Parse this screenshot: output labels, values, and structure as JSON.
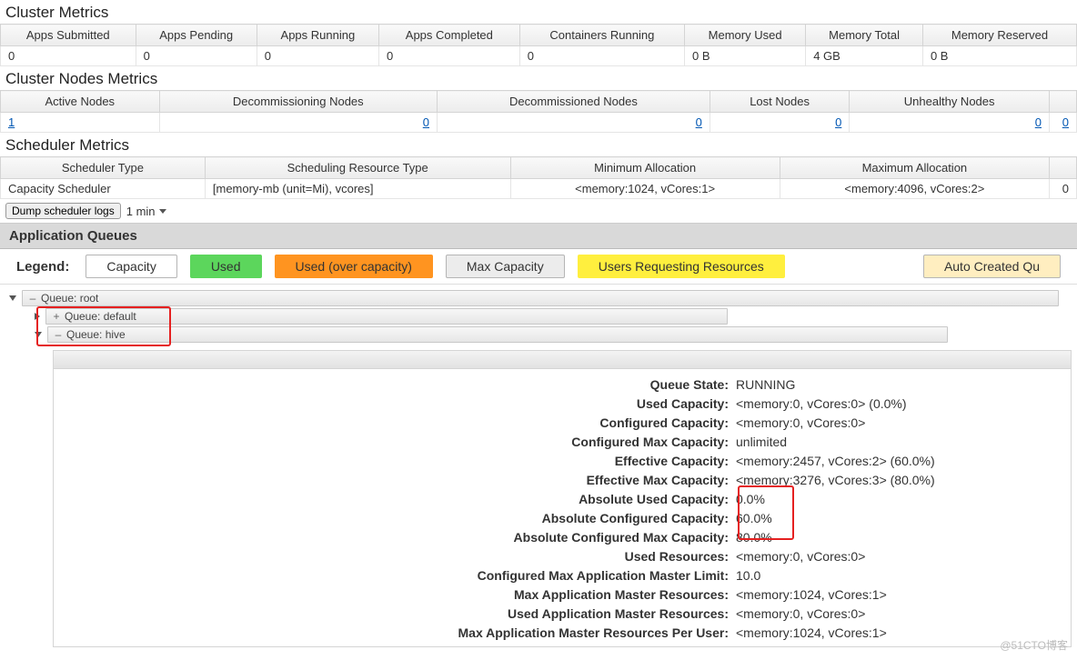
{
  "sections": {
    "cluster": "Cluster Metrics",
    "nodes": "Cluster Nodes Metrics",
    "scheduler": "Scheduler Metrics",
    "appqueues": "Application Queues"
  },
  "cluster_metrics": {
    "headers": [
      "Apps Submitted",
      "Apps Pending",
      "Apps Running",
      "Apps Completed",
      "Containers Running",
      "Memory Used",
      "Memory Total",
      "Memory Reserved"
    ],
    "values": [
      "0",
      "0",
      "0",
      "0",
      "0",
      "0 B",
      "4 GB",
      "0 B"
    ]
  },
  "node_metrics": {
    "headers": [
      "Active Nodes",
      "Decommissioning Nodes",
      "Decommissioned Nodes",
      "Lost Nodes",
      "Unhealthy Nodes",
      ""
    ],
    "values": [
      "1",
      "0",
      "0",
      "0",
      "0",
      "0"
    ]
  },
  "scheduler_metrics": {
    "headers": [
      "Scheduler Type",
      "Scheduling Resource Type",
      "Minimum Allocation",
      "Maximum Allocation",
      ""
    ],
    "values": [
      "Capacity Scheduler",
      "[memory-mb (unit=Mi), vcores]",
      "<memory:1024, vCores:1>",
      "<memory:4096, vCores:2>",
      "0"
    ]
  },
  "dump": {
    "button": "Dump scheduler logs",
    "period": "1 min"
  },
  "legend": {
    "label": "Legend:",
    "capacity": "Capacity",
    "used": "Used",
    "over": "Used (over capacity)",
    "max": "Max Capacity",
    "users": "Users Requesting Resources",
    "auto": "Auto Created Qu"
  },
  "tree": {
    "root": "Queue: root",
    "default": "Queue: default",
    "hive": "Queue: hive"
  },
  "details": {
    "rows": [
      {
        "k": "Queue State:",
        "v": "RUNNING"
      },
      {
        "k": "Used Capacity:",
        "v": "<memory:0, vCores:0> (0.0%)"
      },
      {
        "k": "Configured Capacity:",
        "v": "<memory:0, vCores:0>"
      },
      {
        "k": "Configured Max Capacity:",
        "v": "unlimited"
      },
      {
        "k": "Effective Capacity:",
        "v": "<memory:2457, vCores:2> (60.0%)"
      },
      {
        "k": "Effective Max Capacity:",
        "v": "<memory:3276, vCores:3> (80.0%)"
      },
      {
        "k": "Absolute Used Capacity:",
        "v": "0.0%"
      },
      {
        "k": "Absolute Configured Capacity:",
        "v": "60.0%"
      },
      {
        "k": "Absolute Configured Max Capacity:",
        "v": "80.0%"
      },
      {
        "k": "Used Resources:",
        "v": "<memory:0, vCores:0>"
      },
      {
        "k": "Configured Max Application Master Limit:",
        "v": "10.0"
      },
      {
        "k": "Max Application Master Resources:",
        "v": "<memory:1024, vCores:1>"
      },
      {
        "k": "Used Application Master Resources:",
        "v": "<memory:0, vCores:0>"
      },
      {
        "k": "Max Application Master Resources Per User:",
        "v": "<memory:1024, vCores:1>"
      }
    ]
  },
  "watermark": "@51CTO博客"
}
